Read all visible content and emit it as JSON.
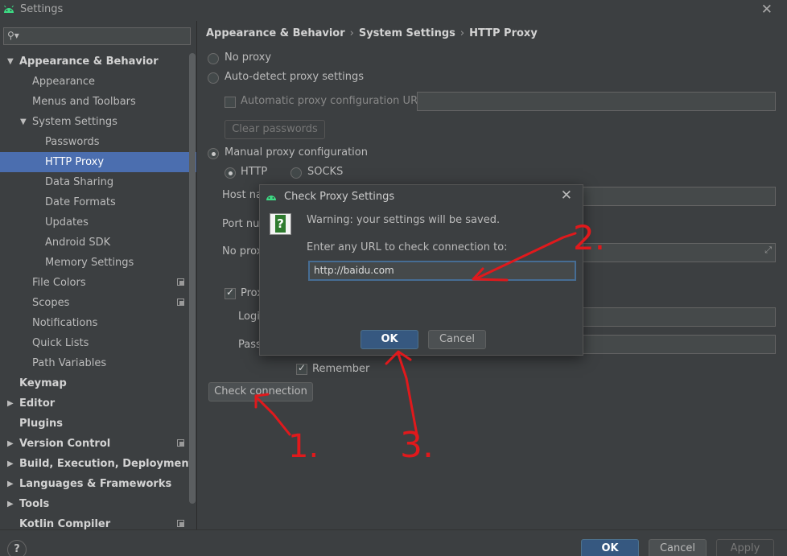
{
  "window": {
    "title": "Settings"
  },
  "sidebar": {
    "search_placeholder": "",
    "items": [
      {
        "label": "Appearance & Behavior",
        "level": 0,
        "bold": true,
        "arrow": "down"
      },
      {
        "label": "Appearance",
        "level": 1
      },
      {
        "label": "Menus and Toolbars",
        "level": 1
      },
      {
        "label": "System Settings",
        "level": 1,
        "arrow": "down"
      },
      {
        "label": "Passwords",
        "level": 2
      },
      {
        "label": "HTTP Proxy",
        "level": 2,
        "selected": true
      },
      {
        "label": "Data Sharing",
        "level": 2
      },
      {
        "label": "Date Formats",
        "level": 2
      },
      {
        "label": "Updates",
        "level": 2
      },
      {
        "label": "Android SDK",
        "level": 2
      },
      {
        "label": "Memory Settings",
        "level": 2
      },
      {
        "label": "File Colors",
        "level": 1,
        "copy": true
      },
      {
        "label": "Scopes",
        "level": 1,
        "copy": true
      },
      {
        "label": "Notifications",
        "level": 1
      },
      {
        "label": "Quick Lists",
        "level": 1
      },
      {
        "label": "Path Variables",
        "level": 1
      },
      {
        "label": "Keymap",
        "level": 0,
        "bold": true
      },
      {
        "label": "Editor",
        "level": 0,
        "bold": true,
        "arrow": "right"
      },
      {
        "label": "Plugins",
        "level": 0,
        "bold": true
      },
      {
        "label": "Version Control",
        "level": 0,
        "bold": true,
        "arrow": "right",
        "copy": true
      },
      {
        "label": "Build, Execution, Deployment",
        "level": 0,
        "bold": true,
        "arrow": "right"
      },
      {
        "label": "Languages & Frameworks",
        "level": 0,
        "bold": true,
        "arrow": "right"
      },
      {
        "label": "Tools",
        "level": 0,
        "bold": true,
        "arrow": "right"
      },
      {
        "label": "Kotlin Compiler",
        "level": 0,
        "bold": true,
        "copy": true
      }
    ]
  },
  "breadcrumb": {
    "part1": "Appearance & Behavior",
    "part2": "System Settings",
    "part3": "HTTP Proxy"
  },
  "proxy": {
    "no_proxy": "No proxy",
    "auto_detect": "Auto-detect proxy settings",
    "auto_config_url": "Automatic proxy configuration URL:",
    "clear_passwords": "Clear passwords",
    "manual": "Manual proxy configuration",
    "http": "HTTP",
    "socks": "SOCKS",
    "host_name": "Host na",
    "port_number": "Port nur",
    "no_proxy_for": "No prox",
    "proxy_auth": "Prox",
    "login": "Logi",
    "password": "Pass",
    "remember": "Remember",
    "check_connection": "Check connection"
  },
  "dialog": {
    "title": "Check Proxy Settings",
    "warning": "Warning: your settings will be saved.",
    "prompt": "Enter any URL to check connection to:",
    "url_value": "http://baidu.com",
    "ok": "OK",
    "cancel": "Cancel"
  },
  "footer": {
    "help": "?",
    "ok": "OK",
    "cancel": "Cancel",
    "apply": "Apply"
  },
  "annotations": {
    "mark1": "1.",
    "mark2": "2.",
    "mark3": "3."
  },
  "colors": {
    "accent": "#4b6eaf",
    "annotation": "#e0191c",
    "default_button": "#365880"
  }
}
